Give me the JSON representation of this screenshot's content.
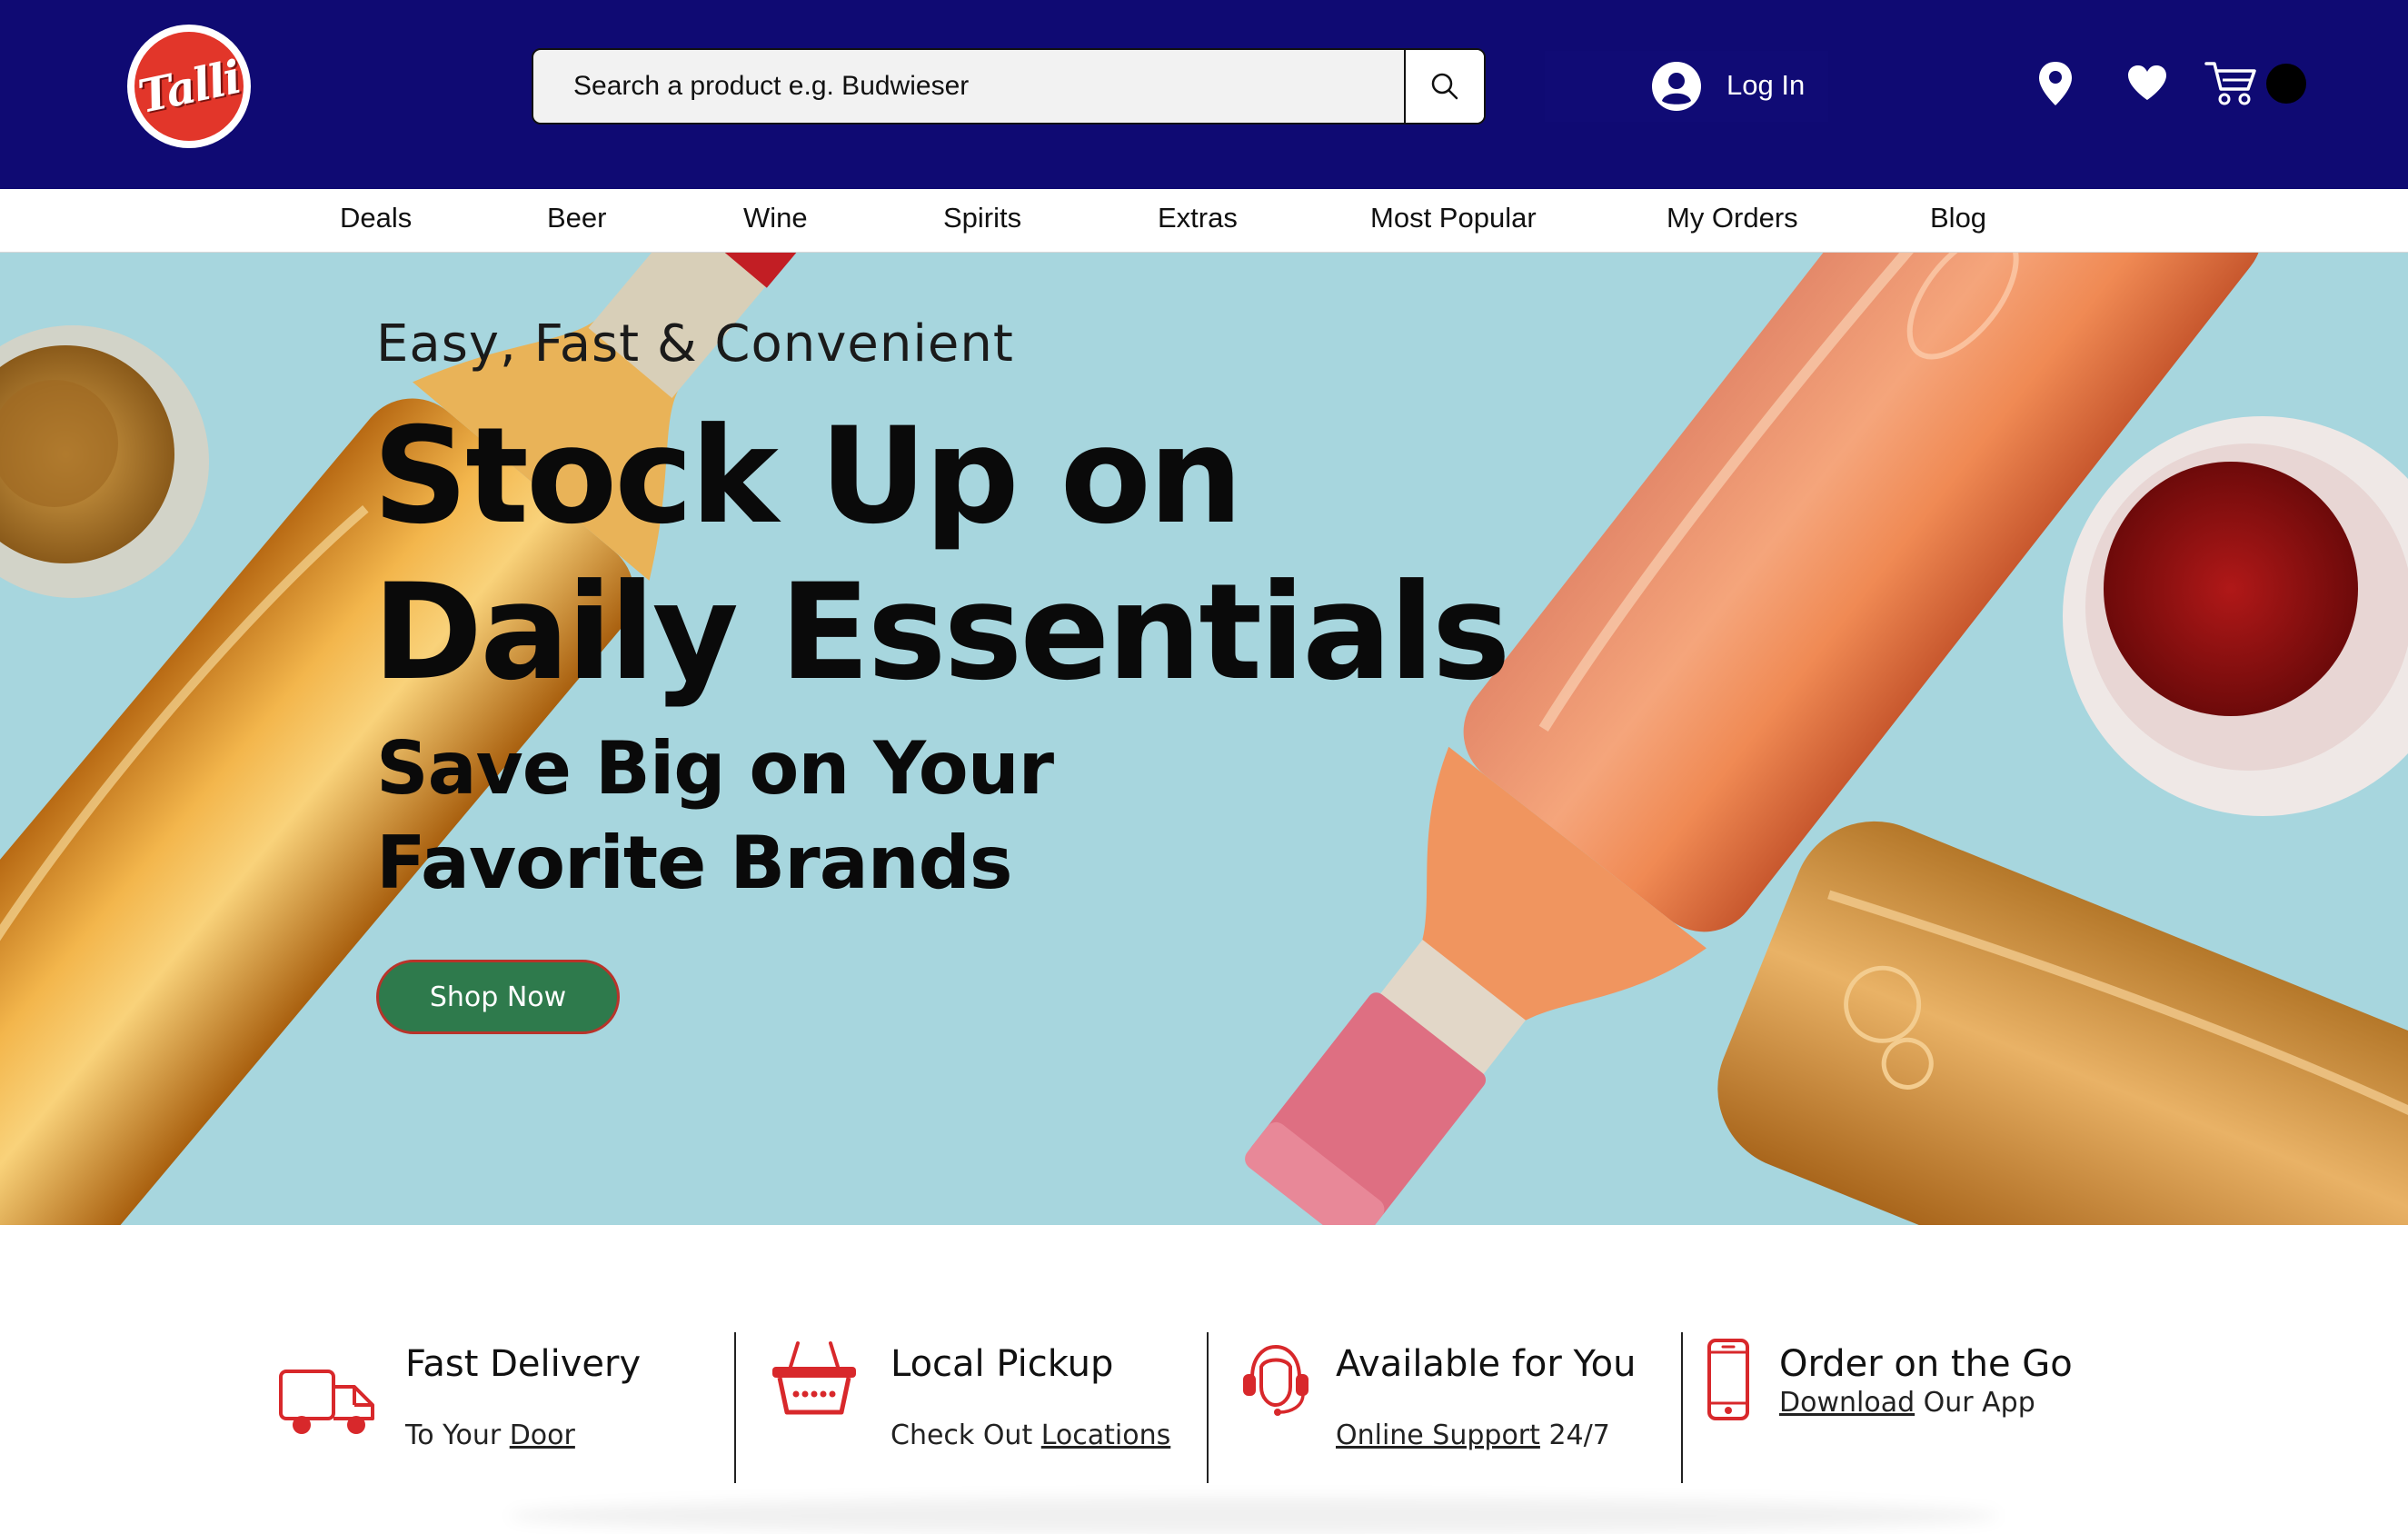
{
  "brand": {
    "logo_text": "Talli"
  },
  "search": {
    "placeholder": "Search a product e.g. Budwieser"
  },
  "account": {
    "login_label": "Log In"
  },
  "nav": {
    "items": [
      "Deals",
      "Beer",
      "Wine",
      "Spirits",
      "Extras",
      "Most Popular",
      "My Orders",
      "Blog"
    ]
  },
  "hero": {
    "eyebrow": "Easy, Fast & Convenient",
    "headline_line1": "Stock Up on",
    "headline_line2": "Daily Essentials",
    "subhead_line1": "Save Big on Your",
    "subhead_line2": "Favorite Brands",
    "cta_label": "Shop Now"
  },
  "features": [
    {
      "title": "Fast Delivery",
      "sub_prefix": "To Your ",
      "sub_link": "Door",
      "sub_suffix": "",
      "icon": "delivery-truck-icon"
    },
    {
      "title": "Local Pickup",
      "sub_prefix": "Check Out ",
      "sub_link": "Locations",
      "sub_suffix": "",
      "icon": "basket-icon"
    },
    {
      "title": "Available for You",
      "sub_prefix": "",
      "sub_link": "Online Support",
      "sub_suffix": " 24/7",
      "icon": "headset-support-icon"
    },
    {
      "title": "Order on the Go",
      "sub_prefix": "",
      "sub_link": "Download",
      "sub_suffix": " Our App",
      "icon": "smartphone-icon"
    }
  ],
  "colors": {
    "header_bg": "#0f0a73",
    "hero_bg": "#a7d6de",
    "cta_bg": "#2e7a4c",
    "accent_red": "#e2362a"
  },
  "icons": {
    "search": "search-icon",
    "user": "user-avatar-icon",
    "location": "location-pin-icon",
    "wishlist": "heart-icon",
    "cart": "cart-icon"
  }
}
